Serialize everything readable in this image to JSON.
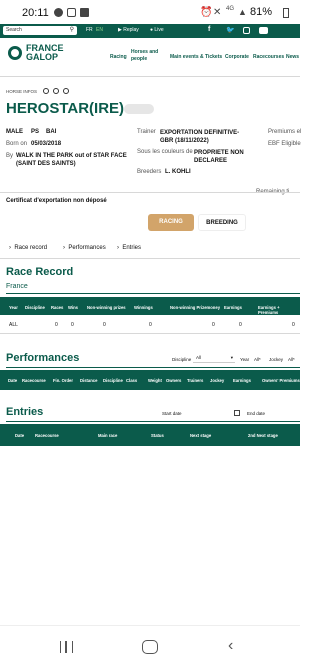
{
  "status": {
    "time": "20:11",
    "battery": "81%"
  },
  "topbar": {
    "search_placeholder": "Search",
    "lang_fr": "FR",
    "lang_en": "EN",
    "replay": "Replay",
    "live": "Live"
  },
  "brand": {
    "line1": "FRANCE",
    "line2": "GALOP"
  },
  "nav": {
    "racing": "Racing",
    "horses": "Horses and people",
    "events": "Main events & Tickets",
    "corporate": "Corporate",
    "racecourses": "Racecourses",
    "news": "News"
  },
  "horse": {
    "info_label": "HORSE INFOS",
    "name": "HEROSTAR(IRE)",
    "sex": "MALE",
    "breed": "PS",
    "color": "BAI",
    "born_label": "Born on",
    "born": "05/03/2018",
    "by_label": "By",
    "pedigree": "WALK IN THE PARK out of STAR FACE (SAINT DES SAINTS)",
    "trainer_label": "Trainer",
    "trainer": "EXPORTATION DEFINITIVE-GBR (18/11/2022)",
    "colors_label": "Sous les couleurs de",
    "owner": "PROPRIETE NON DECLAREE",
    "breeders_label": "Breeders",
    "breeder": "L. KOHLI",
    "premiums": "Premiums el",
    "ebf": "EBF Eligible",
    "remaining": "Remaining ti",
    "export_cert": "Certificat d'exportation non déposé"
  },
  "tabs": {
    "racing": "RACING",
    "breeding": "BREEDING"
  },
  "anchors": {
    "race_record": "Race record",
    "performances": "Performances",
    "entries": "Entries"
  },
  "race_record": {
    "title": "Race Record",
    "country": "France",
    "columns": [
      "Year",
      "Discipline",
      "Races",
      "Wins",
      "Non-winning prizes",
      "Winnings",
      "Non-winning Prizemoney",
      "Earnings",
      "Earnings + Premiums"
    ],
    "row": [
      "ALL",
      "",
      "0",
      "0",
      "0",
      "0",
      "0",
      "0",
      "0"
    ]
  },
  "performances": {
    "title": "Performances",
    "filter_discipline": "Discipline",
    "filter_all": "All",
    "filter_year": "Year",
    "filter_year_val": "All*",
    "filter_jockey": "Jockey",
    "filter_jockey_val": "All*",
    "columns": [
      "Date",
      "Racecourse",
      "Fin. Order",
      "Distance",
      "Discipline",
      "Class",
      "Weight",
      "Owners",
      "Trainers",
      "Jockey",
      "Earnings",
      "Owners' Premiums"
    ]
  },
  "entries": {
    "title": "Entries",
    "start_date": "Start date",
    "end_date": "End date",
    "columns": [
      "Date",
      "Racecourse",
      "Main race",
      "Status",
      "Next stage",
      "2nd Next stage"
    ]
  }
}
